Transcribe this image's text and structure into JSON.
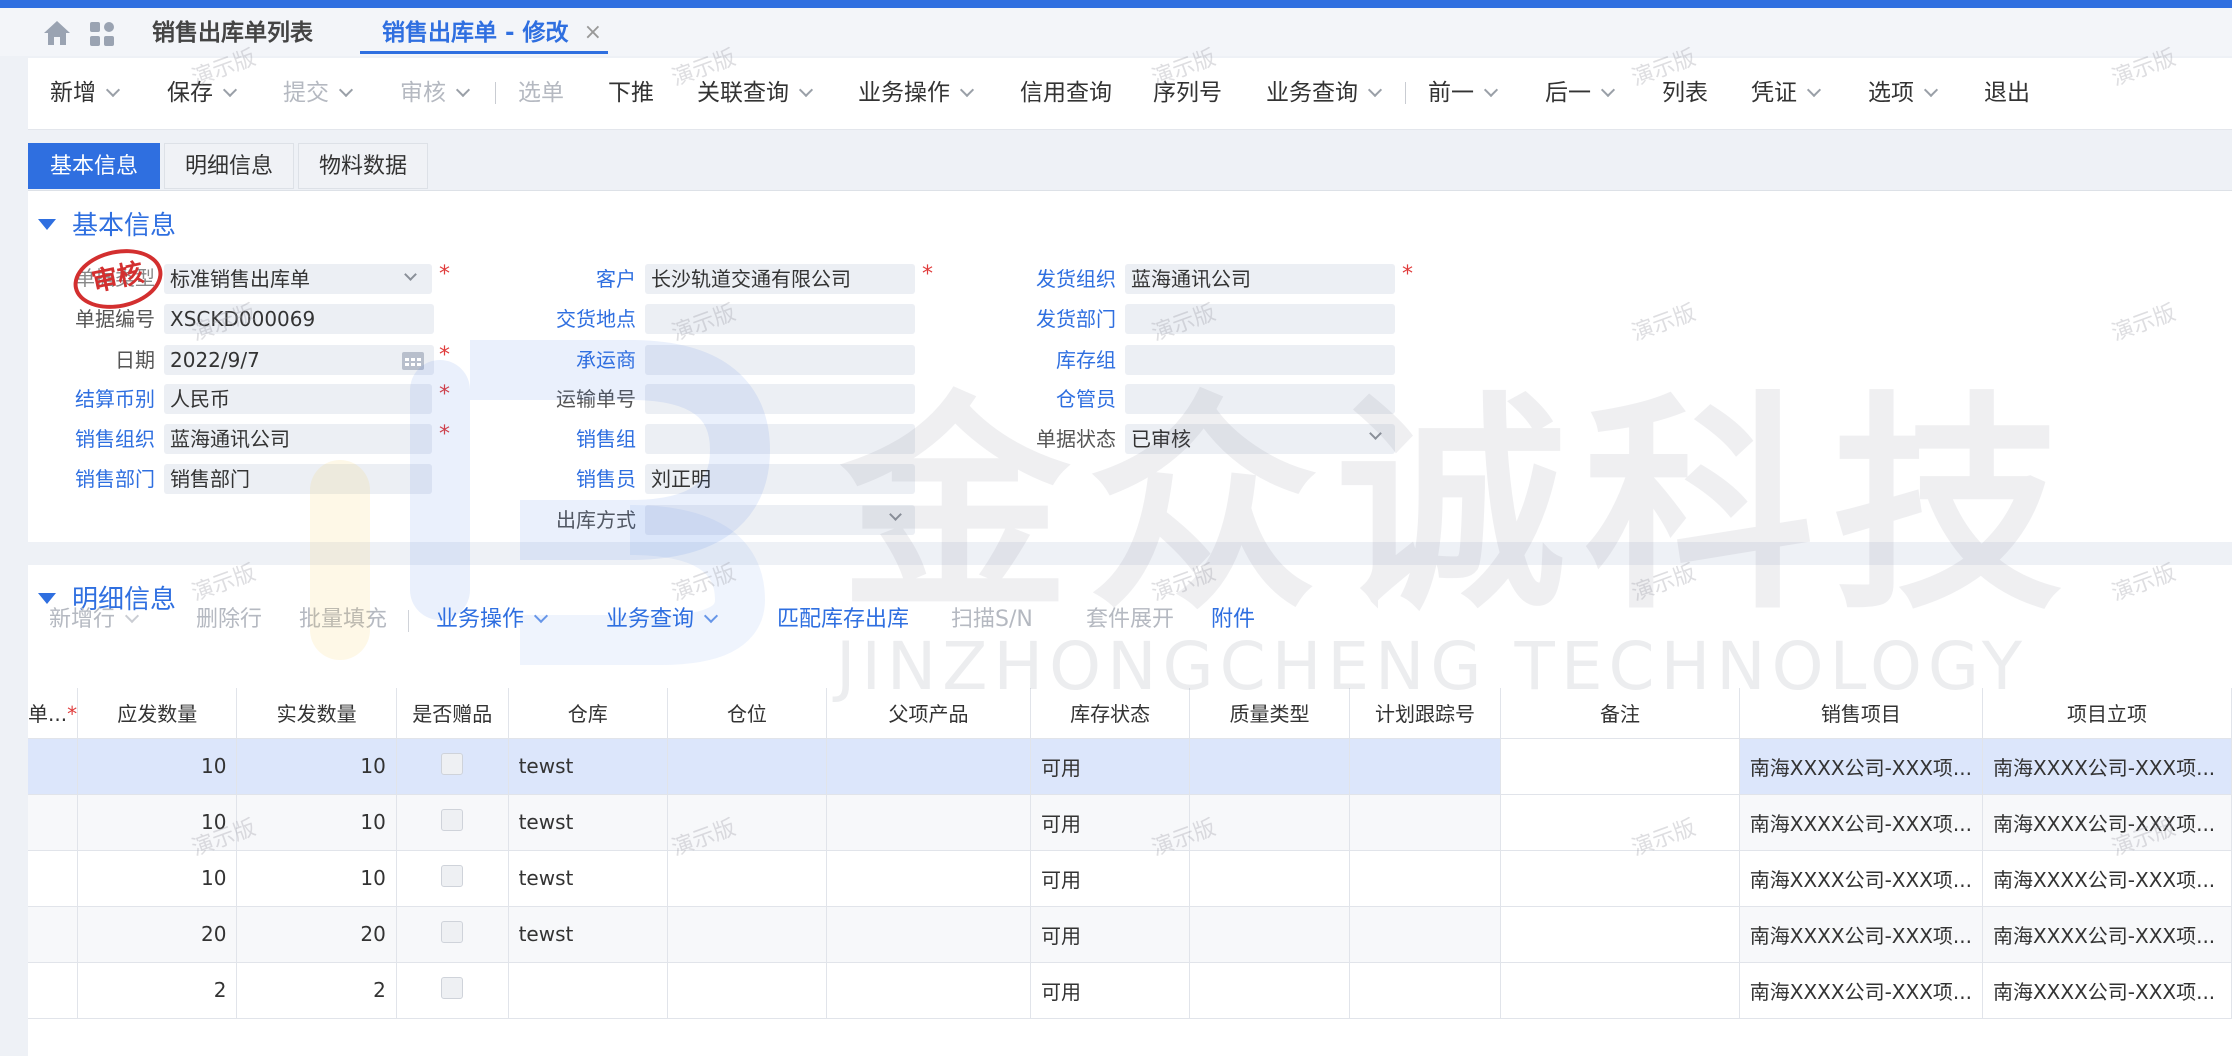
{
  "tabs": {
    "list_tab": "销售出库单列表",
    "edit_tab": "销售出库单 - 修改",
    "close": "×"
  },
  "toolbar": {
    "new": "新增",
    "save": "保存",
    "submit": "提交",
    "audit": "审核",
    "select": "选单",
    "push": "下推",
    "related": "关联查询",
    "business_ops": "业务操作",
    "credit": "信用查询",
    "serial": "序列号",
    "business_query": "业务查询",
    "prev": "前一",
    "next": "后一",
    "list": "列表",
    "voucher": "凭证",
    "options": "选项",
    "exit": "退出"
  },
  "form_tabs": [
    "基本信息",
    "明细信息",
    "物料数据"
  ],
  "basic": {
    "section_title": "基本信息",
    "stamp": "审核",
    "doc_type_label": "单据类型",
    "doc_type": "标准销售出库单",
    "doc_no_label": "单据编号",
    "doc_no": "XSCKD000069",
    "date_label": "日期",
    "date": "2022/9/7",
    "currency_label": "结算币别",
    "currency": "人民币",
    "sales_org_label": "销售组织",
    "sales_org": "蓝海通讯公司",
    "sales_dept_label": "销售部门",
    "sales_dept": "销售部门",
    "customer_label": "客户",
    "customer": "长沙轨道交通有限公司",
    "delivery_place_label": "交货地点",
    "delivery_place": "",
    "carrier_label": "承运商",
    "carrier": "",
    "shipping_no_label": "运输单号",
    "shipping_no": "",
    "sales_group_label": "销售组",
    "sales_group": "",
    "salesperson_label": "销售员",
    "salesperson": "刘正明",
    "out_method_label": "出库方式",
    "out_method": "",
    "ship_org_label": "发货组织",
    "ship_org": "蓝海通讯公司",
    "ship_dept_label": "发货部门",
    "ship_dept": "",
    "stock_group_label": "库存组",
    "stock_group": "",
    "keeper_label": "仓管员",
    "keeper": "",
    "status_label": "单据状态",
    "status": "已审核"
  },
  "detail": {
    "section_title": "明细信息",
    "tools": {
      "add_row": "新增行",
      "delete_row": "删除行",
      "batch_fill": "批量填充",
      "business_ops": "业务操作",
      "business_query": "业务查询",
      "match_stock": "匹配库存出库",
      "scan_sn": "扫描S/N",
      "kit_expand": "套件展开",
      "attachment": "附件"
    },
    "columns": [
      "单...",
      "应发数量",
      "实发数量",
      "是否赠品",
      "仓库",
      "仓位",
      "父项产品",
      "库存状态",
      "质量类型",
      "计划跟踪号",
      "备注",
      "销售项目",
      "项目立项"
    ],
    "rows": [
      {
        "due": "10",
        "actual": "10",
        "warehouse": "tewst",
        "status": "可用",
        "project": "南海XXXX公司-XXX项...",
        "approval": "南海XXXX公司-XXX项..."
      },
      {
        "due": "10",
        "actual": "10",
        "warehouse": "tewst",
        "status": "可用",
        "project": "南海XXXX公司-XXX项...",
        "approval": "南海XXXX公司-XXX项..."
      },
      {
        "due": "10",
        "actual": "10",
        "warehouse": "tewst",
        "status": "可用",
        "project": "南海XXXX公司-XXX项...",
        "approval": "南海XXXX公司-XXX项..."
      },
      {
        "due": "20",
        "actual": "20",
        "warehouse": "tewst",
        "status": "可用",
        "project": "南海XXXX公司-XXX项...",
        "approval": "南海XXXX公司-XXX项..."
      },
      {
        "due": "2",
        "actual": "2",
        "warehouse": "",
        "status": "可用",
        "project": "南海XXXX公司-XXX项...",
        "approval": "南海XXXX公司-XXX项..."
      }
    ]
  },
  "watermark": {
    "demo": "演示版",
    "brand_cn": "金众诚科技",
    "brand_en": "JINZHONGCHENG TECHNOLOGY"
  },
  "colors": {
    "accent": "#2f6fe0",
    "required": "#e03c3c",
    "stamp": "#d32f2f",
    "selected_row": "#dce6fb"
  }
}
